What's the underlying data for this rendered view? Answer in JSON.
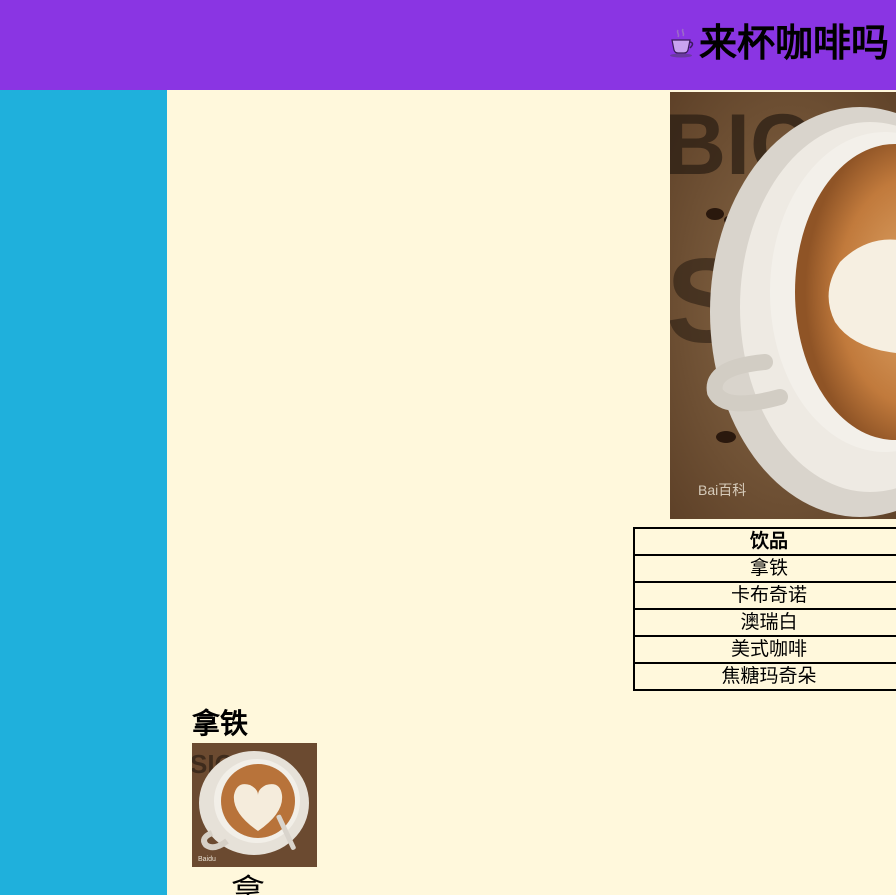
{
  "header": {
    "site_title": "来杯咖啡吗",
    "icon": "coffee-cup-icon",
    "bg_color": "#8a35e3"
  },
  "sidebar": {
    "bg_color": "#1fb0dc"
  },
  "main": {
    "bg_color": "#fff8dc",
    "hero_image": {
      "alt": "coffee-latte-art-image",
      "watermark": "Bai百科"
    },
    "table": {
      "header": "饮品",
      "rows": [
        "拿铁",
        "卡布奇诺",
        "澳瑞白",
        "美式咖啡",
        "焦糖玛奇朵"
      ]
    },
    "section": {
      "title": "拿铁",
      "image": {
        "alt": "latte-thumbnail-image",
        "watermark": "Baidu"
      }
    },
    "next_section_title": "拿"
  }
}
